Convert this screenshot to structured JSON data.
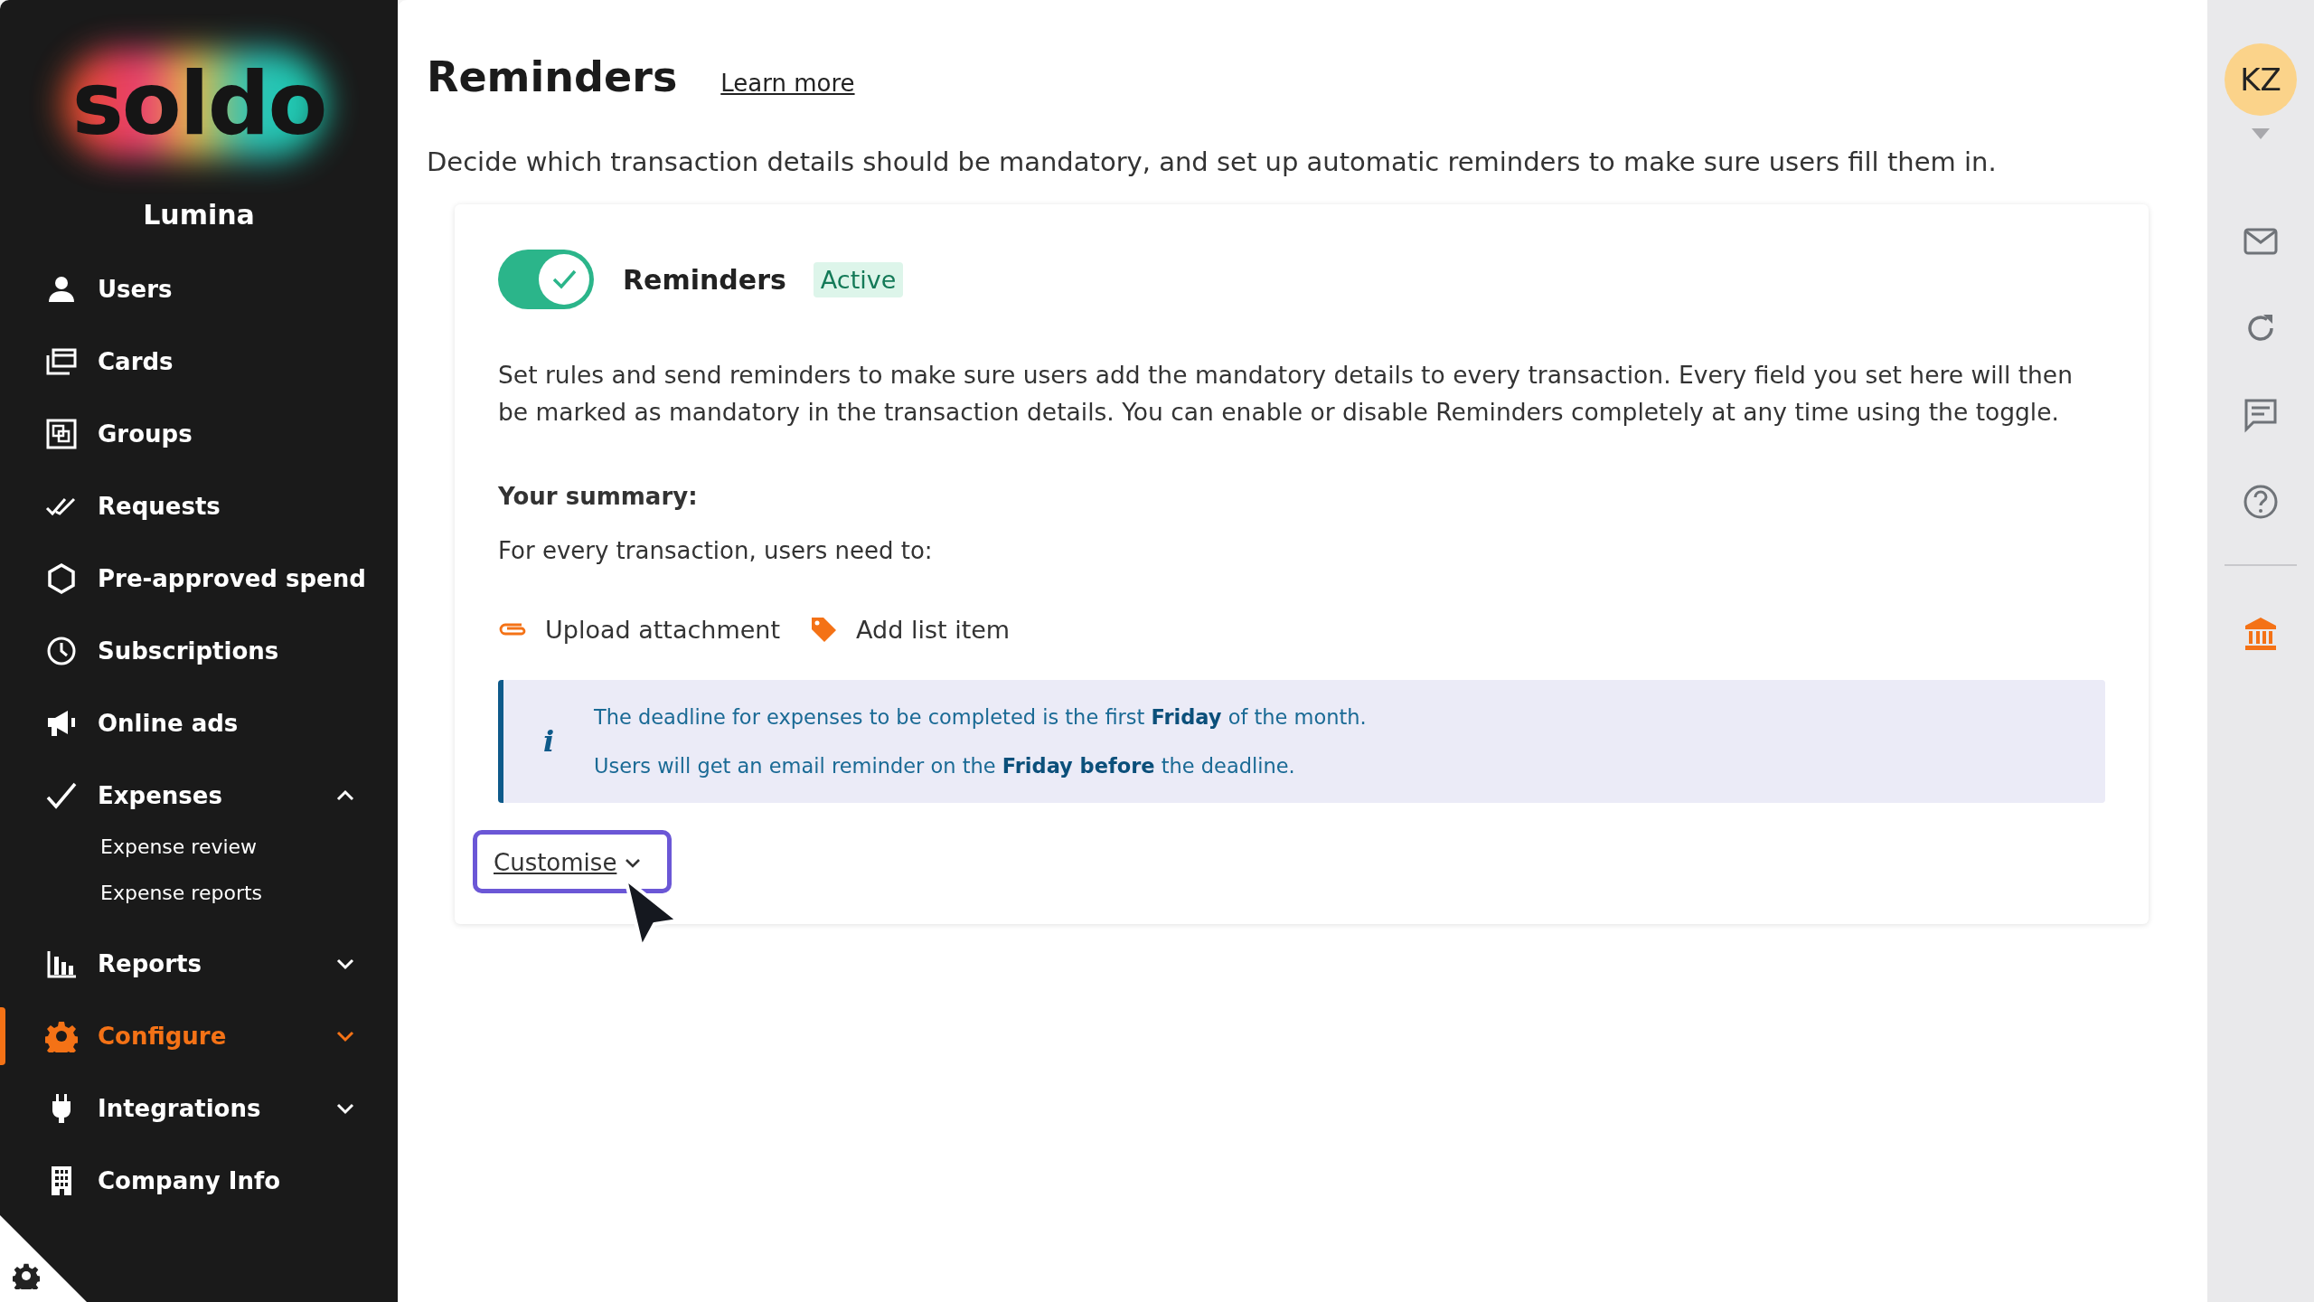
{
  "sidebar": {
    "logo": "soldo",
    "company": "Lumina",
    "items": [
      {
        "label": "Users",
        "kind": "link",
        "selected": false
      },
      {
        "label": "Cards",
        "kind": "link",
        "selected": false
      },
      {
        "label": "Groups",
        "kind": "link",
        "selected": false
      },
      {
        "label": "Requests",
        "kind": "link",
        "selected": false
      },
      {
        "label": "Pre-approved spend",
        "kind": "link",
        "selected": false
      },
      {
        "label": "Subscriptions",
        "kind": "link",
        "selected": false
      },
      {
        "label": "Online ads",
        "kind": "link",
        "selected": false
      },
      {
        "label": "Expenses",
        "kind": "group",
        "selected": false,
        "expanded": true,
        "children": [
          {
            "label": "Expense review"
          },
          {
            "label": "Expense reports"
          }
        ]
      },
      {
        "label": "Reports",
        "kind": "group",
        "selected": false,
        "expanded": false
      },
      {
        "label": "Configure",
        "kind": "group",
        "selected": true,
        "expanded": false
      },
      {
        "label": "Integrations",
        "kind": "group",
        "selected": false,
        "expanded": false
      },
      {
        "label": "Company Info",
        "kind": "link",
        "selected": false
      }
    ]
  },
  "page": {
    "title": "Reminders",
    "link": "Learn more",
    "description": "Decide which transaction details should be mandatory, and set up automatic reminders to make sure users fill them in."
  },
  "card": {
    "toggle": {
      "on": true
    },
    "label": "Reminders",
    "badge": "Active",
    "body": "Set rules and send reminders to make sure users add the mandatory details to every transaction. Every field you set here will then be marked as mandatory in the transaction details. You can enable or disable Reminders completely at any time using the toggle.",
    "summary_heading": "Your summary:",
    "summary_intro": "For every transaction, users need to:",
    "requirements": [
      {
        "label": "Upload attachment"
      },
      {
        "label": "Add list item"
      }
    ],
    "info": [
      "The deadline for expenses to be completed is the first **Friday** of the month.",
      "Users will get an email reminder on the **Friday before** the deadline."
    ],
    "info_icon": "i",
    "customise": {
      "label": "Customise",
      "focused": true
    }
  },
  "rail": {
    "avatar": "KZ"
  }
}
